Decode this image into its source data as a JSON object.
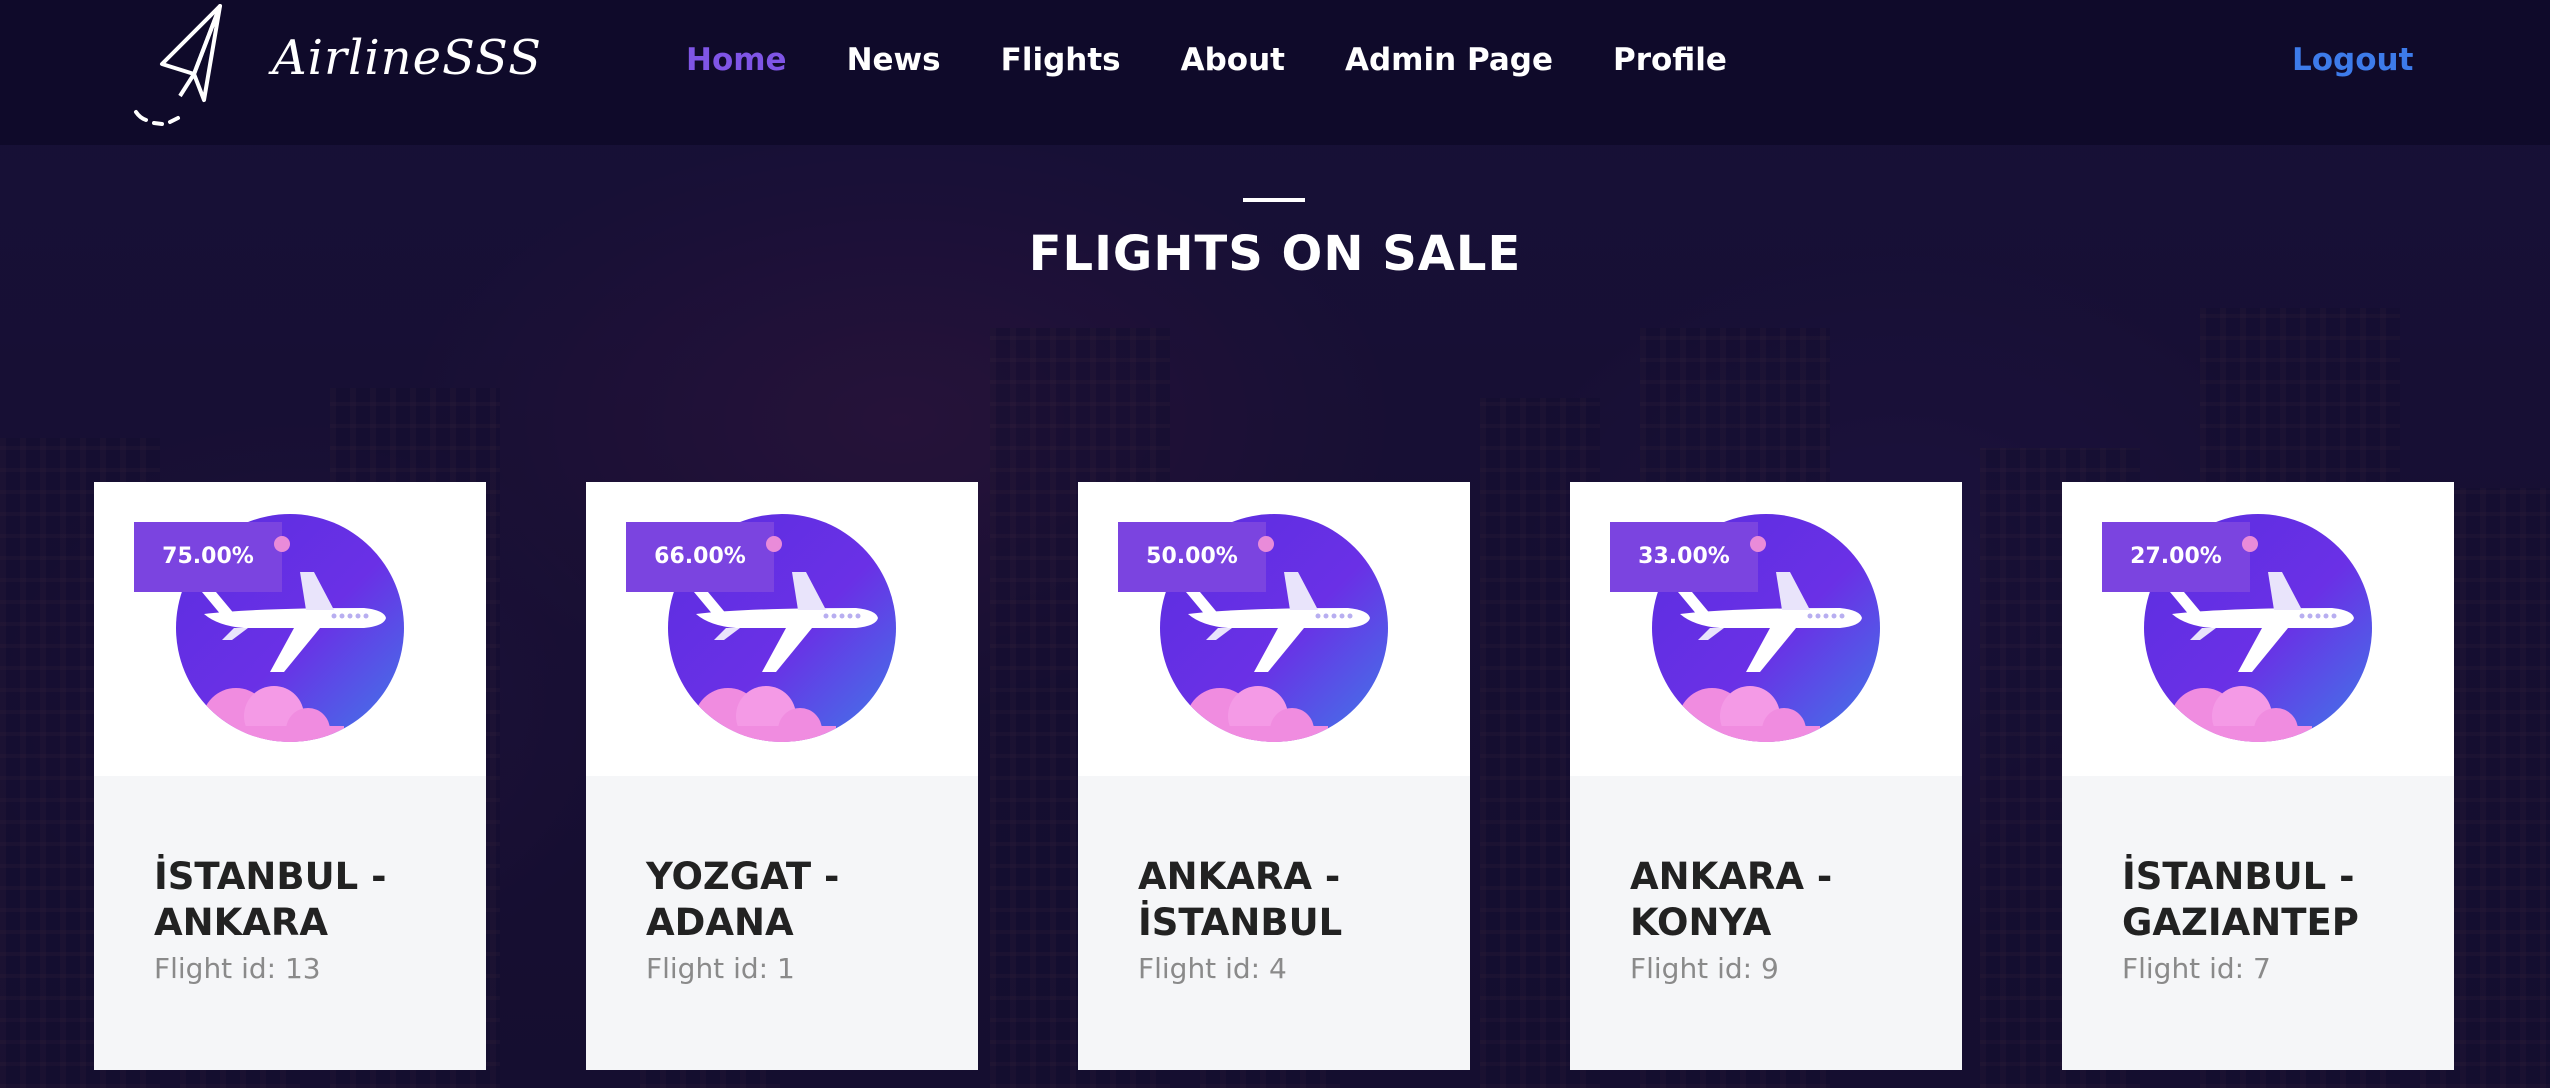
{
  "nav": {
    "brand": "AirlineSSS",
    "links": [
      "Home",
      "News",
      "Flights",
      "About",
      "Admin Page",
      "Profile"
    ],
    "active": "Home",
    "logout": "Logout"
  },
  "section": {
    "title": "FLIGHTS ON SALE"
  },
  "flights": [
    {
      "discount": "75.00%",
      "route_line1": "İSTANBUL -",
      "route_line2": "ANKARA",
      "flight_id": "Flight id: 13"
    },
    {
      "discount": "66.00%",
      "route_line1": "YOZGAT -",
      "route_line2": "ADANA",
      "flight_id": "Flight id: 1"
    },
    {
      "discount": "50.00%",
      "route_line1": "ANKARA -",
      "route_line2": "İSTANBUL",
      "flight_id": "Flight id: 4"
    },
    {
      "discount": "33.00%",
      "route_line1": "ANKARA -",
      "route_line2": "KONYA",
      "flight_id": "Flight id: 9"
    },
    {
      "discount": "27.00%",
      "route_line1": "İSTANBUL -",
      "route_line2": "GAZIANTEP",
      "flight_id": "Flight id: 7"
    }
  ],
  "colors": {
    "navbar_bg": "#0f0a2a",
    "active_link": "#7f55e6",
    "logout": "#3d7bea",
    "discount_badge": "#7b44e0",
    "card_bottom": "#f5f6f8"
  },
  "icons": [
    "paper-plane-logo-icon",
    "airplane-icon"
  ]
}
